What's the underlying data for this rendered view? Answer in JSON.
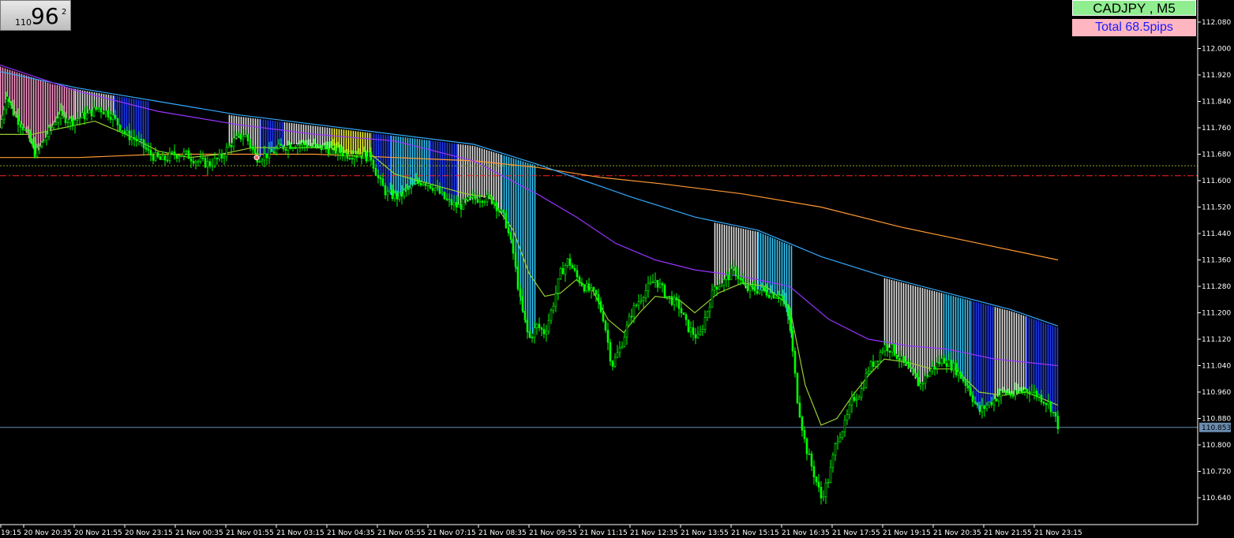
{
  "price_box": {
    "small": "110",
    "big": "96",
    "sup": "2"
  },
  "symbol_label": "CADJPY , M5",
  "pips_label": "Total  68.5pips",
  "current_price": "110.853",
  "colors": {
    "background": "#000000",
    "candle": "#00ff00",
    "ma_fast": "#9acd32",
    "ma_purple": "#9933ff",
    "ma_blue": "#33aaff",
    "ma_orange": "#ff9933",
    "band_blue": "#1e3cff",
    "band_cyan": "#33ccff",
    "band_white": "#e6e6e6",
    "band_yellow": "#ffff33",
    "band_pink": "#ff99cc",
    "level_red": "#ff2222",
    "level_green": "#88aa22",
    "current_line": "#6a8caf",
    "axis_text": "#ffffff"
  },
  "chart_data": {
    "type": "candlestick",
    "symbol": "CADJPY",
    "timeframe": "M5",
    "ylim": [
      110.56,
      112.12
    ],
    "y_ticks": [
      "112.080",
      "112.000",
      "111.920",
      "111.840",
      "111.760",
      "111.680",
      "111.600",
      "111.520",
      "111.440",
      "111.360",
      "111.280",
      "111.200",
      "111.120",
      "111.040",
      "110.960",
      "110.880",
      "110.800",
      "110.720",
      "110.640"
    ],
    "x_ticks": [
      "19:15",
      "20 Nov 20:35",
      "20 Nov 21:55",
      "20 Nov 23:15",
      "21 Nov 00:35",
      "21 Nov 01:55",
      "21 Nov 03:15",
      "21 Nov 04:35",
      "21 Nov 05:55",
      "21 Nov 07:15",
      "21 Nov 08:35",
      "21 Nov 09:55",
      "21 Nov 11:15",
      "21 Nov 12:35",
      "21 Nov 13:55",
      "21 Nov 15:15",
      "21 Nov 16:35",
      "21 Nov 17:55",
      "21 Nov 19:15",
      "21 Nov 20:35",
      "21 Nov 21:55",
      "21 Nov 23:15"
    ],
    "price_path": [
      [
        0,
        111.76
      ],
      [
        8,
        111.86
      ],
      [
        18,
        111.8
      ],
      [
        30,
        111.76
      ],
      [
        45,
        111.68
      ],
      [
        60,
        111.74
      ],
      [
        75,
        111.8
      ],
      [
        90,
        111.78
      ],
      [
        110,
        111.8
      ],
      [
        125,
        111.82
      ],
      [
        140,
        111.8
      ],
      [
        160,
        111.74
      ],
      [
        175,
        111.72
      ],
      [
        190,
        111.68
      ],
      [
        205,
        111.66
      ],
      [
        220,
        111.68
      ],
      [
        235,
        111.68
      ],
      [
        250,
        111.66
      ],
      [
        265,
        111.65
      ],
      [
        280,
        111.67
      ],
      [
        295,
        111.72
      ],
      [
        310,
        111.74
      ],
      [
        325,
        111.67
      ],
      [
        340,
        111.68
      ],
      [
        355,
        111.7
      ],
      [
        370,
        111.71
      ],
      [
        385,
        111.71
      ],
      [
        400,
        111.7
      ],
      [
        410,
        111.7
      ],
      [
        425,
        111.69
      ],
      [
        440,
        111.68
      ],
      [
        455,
        111.68
      ],
      [
        470,
        111.67
      ],
      [
        480,
        111.6
      ],
      [
        490,
        111.56
      ],
      [
        505,
        111.55
      ],
      [
        520,
        111.58
      ],
      [
        535,
        111.6
      ],
      [
        550,
        111.58
      ],
      [
        565,
        111.54
      ],
      [
        580,
        111.52
      ],
      [
        595,
        111.54
      ],
      [
        610,
        111.55
      ],
      [
        625,
        111.54
      ],
      [
        640,
        111.48
      ],
      [
        650,
        111.38
      ],
      [
        660,
        111.22
      ],
      [
        670,
        111.12
      ],
      [
        680,
        111.16
      ],
      [
        690,
        111.14
      ],
      [
        700,
        111.22
      ],
      [
        710,
        111.32
      ],
      [
        720,
        111.36
      ],
      [
        730,
        111.31
      ],
      [
        740,
        111.28
      ],
      [
        755,
        111.25
      ],
      [
        765,
        111.18
      ],
      [
        775,
        111.04
      ],
      [
        785,
        111.09
      ],
      [
        800,
        111.2
      ],
      [
        815,
        111.26
      ],
      [
        830,
        111.3
      ],
      [
        845,
        111.25
      ],
      [
        860,
        111.22
      ],
      [
        870,
        111.16
      ],
      [
        885,
        111.12
      ],
      [
        895,
        111.2
      ],
      [
        905,
        111.28
      ],
      [
        915,
        111.29
      ],
      [
        930,
        111.33
      ],
      [
        945,
        111.27
      ],
      [
        960,
        111.27
      ],
      [
        975,
        111.26
      ],
      [
        990,
        111.25
      ],
      [
        1000,
        111.17
      ],
      [
        1010,
        110.94
      ],
      [
        1020,
        110.8
      ],
      [
        1030,
        110.72
      ],
      [
        1040,
        110.64
      ],
      [
        1050,
        110.7
      ],
      [
        1060,
        110.82
      ],
      [
        1070,
        110.86
      ],
      [
        1080,
        110.94
      ],
      [
        1090,
        110.96
      ],
      [
        1100,
        111.03
      ],
      [
        1110,
        111.06
      ],
      [
        1120,
        111.1
      ],
      [
        1130,
        111.09
      ],
      [
        1140,
        111.06
      ],
      [
        1150,
        111.03
      ],
      [
        1165,
        110.98
      ],
      [
        1180,
        111.03
      ],
      [
        1195,
        111.06
      ],
      [
        1210,
        111.03
      ],
      [
        1225,
        110.98
      ],
      [
        1240,
        110.9
      ],
      [
        1255,
        110.93
      ],
      [
        1270,
        110.96
      ],
      [
        1285,
        110.95
      ],
      [
        1300,
        110.97
      ],
      [
        1315,
        110.95
      ],
      [
        1330,
        110.92
      ],
      [
        1340,
        110.86
      ]
    ],
    "ma_fast_path": [
      [
        0,
        111.74
      ],
      [
        40,
        111.74
      ],
      [
        80,
        111.76
      ],
      [
        120,
        111.78
      ],
      [
        160,
        111.74
      ],
      [
        200,
        111.69
      ],
      [
        240,
        111.67
      ],
      [
        280,
        111.68
      ],
      [
        320,
        111.7
      ],
      [
        360,
        111.7
      ],
      [
        400,
        111.7
      ],
      [
        440,
        111.69
      ],
      [
        470,
        111.68
      ],
      [
        500,
        111.62
      ],
      [
        530,
        111.6
      ],
      [
        560,
        111.58
      ],
      [
        590,
        111.56
      ],
      [
        620,
        111.55
      ],
      [
        650,
        111.45
      ],
      [
        670,
        111.32
      ],
      [
        690,
        111.25
      ],
      [
        710,
        111.26
      ],
      [
        730,
        111.3
      ],
      [
        750,
        111.27
      ],
      [
        770,
        111.18
      ],
      [
        790,
        111.14
      ],
      [
        810,
        111.2
      ],
      [
        830,
        111.25
      ],
      [
        860,
        111.24
      ],
      [
        880,
        111.2
      ],
      [
        910,
        111.26
      ],
      [
        940,
        111.29
      ],
      [
        970,
        111.28
      ],
      [
        1000,
        111.22
      ],
      [
        1020,
        110.98
      ],
      [
        1040,
        110.86
      ],
      [
        1060,
        110.88
      ],
      [
        1080,
        110.95
      ],
      [
        1100,
        111.01
      ],
      [
        1120,
        111.06
      ],
      [
        1150,
        111.05
      ],
      [
        1180,
        111.03
      ],
      [
        1210,
        111.03
      ],
      [
        1240,
        110.96
      ],
      [
        1270,
        110.95
      ],
      [
        1300,
        110.96
      ],
      [
        1340,
        110.92
      ]
    ],
    "ma_purple_path": [
      [
        0,
        111.95
      ],
      [
        100,
        111.87
      ],
      [
        200,
        111.81
      ],
      [
        300,
        111.77
      ],
      [
        400,
        111.74
      ],
      [
        500,
        111.72
      ],
      [
        600,
        111.66
      ],
      [
        680,
        111.56
      ],
      [
        730,
        111.49
      ],
      [
        780,
        111.41
      ],
      [
        830,
        111.36
      ],
      [
        880,
        111.33
      ],
      [
        940,
        111.31
      ],
      [
        1000,
        111.28
      ],
      [
        1050,
        111.18
      ],
      [
        1100,
        111.12
      ],
      [
        1150,
        111.1
      ],
      [
        1200,
        111.09
      ],
      [
        1260,
        111.06
      ],
      [
        1340,
        111.04
      ]
    ],
    "ma_blue_path": [
      [
        0,
        111.93
      ],
      [
        100,
        111.88
      ],
      [
        200,
        111.84
      ],
      [
        300,
        111.8
      ],
      [
        400,
        111.77
      ],
      [
        500,
        111.74
      ],
      [
        600,
        111.71
      ],
      [
        680,
        111.65
      ],
      [
        740,
        111.6
      ],
      [
        800,
        111.55
      ],
      [
        880,
        111.49
      ],
      [
        960,
        111.45
      ],
      [
        1040,
        111.37
      ],
      [
        1120,
        111.31
      ],
      [
        1200,
        111.26
      ],
      [
        1280,
        111.21
      ],
      [
        1340,
        111.16
      ]
    ],
    "ma_orange_path": [
      [
        0,
        111.67
      ],
      [
        100,
        111.67
      ],
      [
        200,
        111.68
      ],
      [
        300,
        111.68
      ],
      [
        400,
        111.68
      ],
      [
        500,
        111.67
      ],
      [
        600,
        111.66
      ],
      [
        680,
        111.64
      ],
      [
        760,
        111.61
      ],
      [
        840,
        111.59
      ],
      [
        940,
        111.56
      ],
      [
        1040,
        111.52
      ],
      [
        1140,
        111.46
      ],
      [
        1240,
        111.41
      ],
      [
        1340,
        111.36
      ]
    ],
    "levels": [
      {
        "price": 111.645,
        "style": "dotted",
        "color": "level_green"
      },
      {
        "price": 111.615,
        "style": "dashdot",
        "color": "level_red"
      },
      {
        "price": 110.853,
        "style": "solid",
        "color": "current_line"
      }
    ],
    "bands": [
      {
        "x0": 0,
        "x1": 95,
        "color": "band_pink"
      },
      {
        "x0": 95,
        "x1": 145,
        "color": "band_white"
      },
      {
        "x0": 145,
        "x1": 190,
        "color": "band_blue"
      },
      {
        "x0": 290,
        "x1": 330,
        "color": "band_white"
      },
      {
        "x0": 330,
        "x1": 360,
        "color": "band_blue"
      },
      {
        "x0": 360,
        "x1": 420,
        "color": "band_white"
      },
      {
        "x0": 420,
        "x1": 470,
        "color": "band_yellow"
      },
      {
        "x0": 470,
        "x1": 495,
        "color": "band_blue"
      },
      {
        "x0": 495,
        "x1": 545,
        "color": "band_cyan"
      },
      {
        "x0": 545,
        "x1": 580,
        "color": "band_blue"
      },
      {
        "x0": 580,
        "x1": 635,
        "color": "band_white"
      },
      {
        "x0": 635,
        "x1": 680,
        "color": "band_cyan"
      },
      {
        "x0": 905,
        "x1": 960,
        "color": "band_white"
      },
      {
        "x0": 960,
        "x1": 1005,
        "color": "band_cyan"
      },
      {
        "x0": 1120,
        "x1": 1195,
        "color": "band_white"
      },
      {
        "x0": 1195,
        "x1": 1230,
        "color": "band_cyan"
      },
      {
        "x0": 1230,
        "x1": 1260,
        "color": "band_blue"
      },
      {
        "x0": 1260,
        "x1": 1300,
        "color": "band_white"
      },
      {
        "x0": 1300,
        "x1": 1340,
        "color": "band_blue"
      }
    ]
  }
}
